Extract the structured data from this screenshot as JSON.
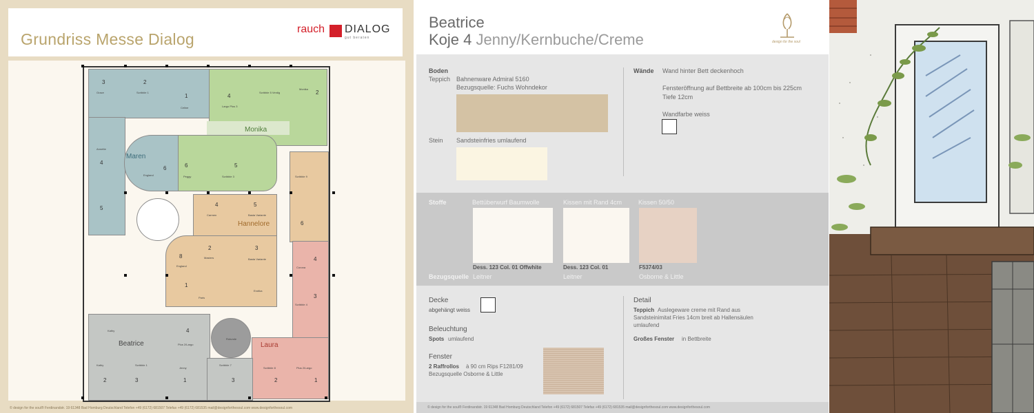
{
  "left": {
    "title": "Grundriss Messe Dialog",
    "logo": {
      "brand": "rauch",
      "name": "DIALOG",
      "tagline": "gut beraten"
    },
    "rooms": {
      "maren": "Maren",
      "monika": "Monika",
      "hannelore": "Hannelore",
      "beatrice": "Beatrice",
      "laura": "Laura"
    },
    "room_numbers": [
      "1",
      "2",
      "3",
      "4",
      "5",
      "6",
      "7",
      "8"
    ],
    "small_labels": {
      "grace": "Grace",
      "scribble1": "Scribble 1",
      "celine": "Celine",
      "largo_plus3": "Largo Plus 3",
      "scribble5": "Scribble 5 Verdig",
      "monika_small": "Monika",
      "annette": "Annette",
      "england": "England",
      "peggy": "Peggy",
      "scribble3": "Scribble 3",
      "scribble9": "Scribble 9",
      "carmen": "Carmen",
      "basta": "Basta Variante",
      "masters": "Masters",
      "paris": "Paris",
      "corona": "Corona",
      "scribble4": "Scribble 4",
      "kathy": "Kathy",
      "plus2largo": "Plus 2/Largo",
      "kathy2": "Kathy",
      "scribble1b": "Scribble 1",
      "jenny": "Jenny",
      "scribble7": "Scribble 7",
      "rotunde": "Rotunde",
      "scribble8": "Scribble 8",
      "plus2largo_b": "Plus 2/Largo",
      "erotika": "Erotika"
    },
    "footer": "© design for the soul® Ferdinandstr. 19 61348 Bad Homburg Deutschland Telefon +49 (6172) 681507 Telefax +49 (6172) 681535 mail@designforthesoul.com www.designforthesoul.com"
  },
  "middle": {
    "name": "Beatrice",
    "koje": "Koje 4",
    "variant": "Jenny/Kernbuche/Creme",
    "boden": {
      "heading": "Boden",
      "teppich_label": "Teppich",
      "teppich_value": "Bahnenware Admiral 5160",
      "bezug": "Bezugsquelle: Fuchs Wohndekor",
      "stein_label": "Stein",
      "stein_value": "Sandsteinfries umlaufend"
    },
    "waende": {
      "heading": "Wände",
      "line1": "Wand hinter Bett deckenhoch",
      "line2": "Fensteröffnung auf Bettbreite ab 100cm bis 225cm",
      "line3": "Tiefe 12cm",
      "farbe": "Wandfarbe weiss"
    },
    "stoffe": {
      "heading": "Stoffe",
      "bezug_label": "Bezugsquelle",
      "items": [
        {
          "title": "Bettüberwurf Baumwolle",
          "code": "Dess. 123 Col. 01 Offwhite",
          "source": "Leitner"
        },
        {
          "title": "Kissen mit Rand 4cm",
          "code": "Dess. 123 Col. 01",
          "source": "Leitner"
        },
        {
          "title": "Kissen 50/50",
          "code": "F5374/03",
          "source": "Osborne & Little"
        }
      ]
    },
    "decke": {
      "heading": "Decke",
      "value": "abgehängt weiss"
    },
    "beleuchtung": {
      "heading": "Beleuchtung",
      "bold": "Spots",
      "value": "umlaufend"
    },
    "fenster": {
      "heading": "Fenster",
      "bold": "2 Raffrollos",
      "value": "à 90 cm Rips F1281/09",
      "bezug": "Bezugsquelle Osborne & Little"
    },
    "detail": {
      "heading": "Detail",
      "teppich_bold": "Teppich",
      "teppich_value1": "Auslegeware creme mit Rand aus",
      "teppich_value2": "Sandsteinimitat Fries 14cm breit ab Hallensäulen",
      "teppich_value3": "umlaufend",
      "fenster_bold": "Großes Fenster",
      "fenster_value": "in Bettbreite"
    },
    "brand_tagline": "design for the soul",
    "footer": "© design for the soul® Ferdinandstr. 19 61348 Bad Homburg Deutschland Telefon +49 (6172) 681507 Telefax +49 (6172) 681535 mail@designforthesoul.com www.designforthesoul.com"
  },
  "colors": {
    "beige_bg": "#e8dcc3",
    "title_gold": "#b9a46c",
    "rauch_red": "#d4202a",
    "room_blue": "#a9c3c6",
    "room_green": "#b9d79b",
    "room_tan": "#e8c9a0",
    "room_gray": "#c4c7c4",
    "room_red": "#eab4aa",
    "swatch_carpet": "#d4c2a4"
  }
}
